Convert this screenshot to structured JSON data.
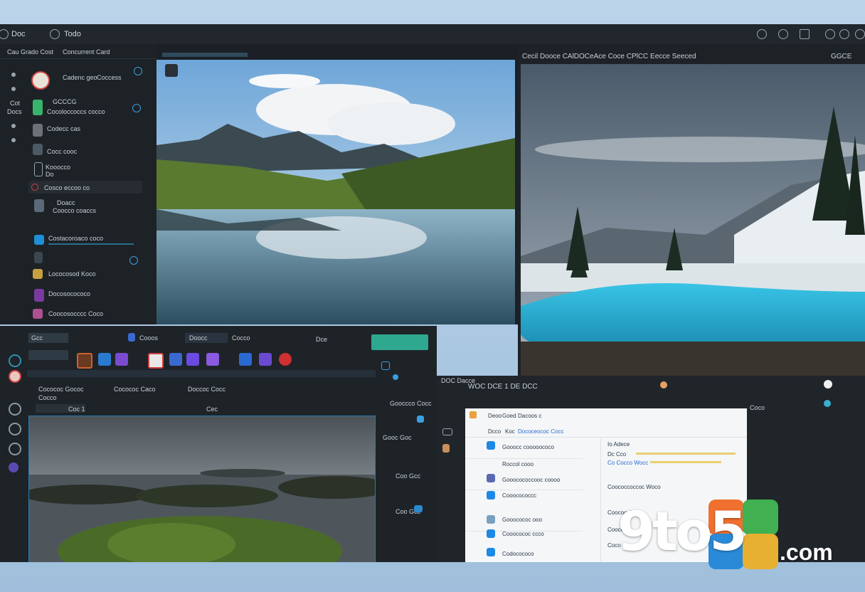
{
  "topbar": {
    "app_label": "Doc",
    "menu_label": "Todo"
  },
  "sidebar": {
    "header": "Cau Grado Cost",
    "header2": "Concurrent Card",
    "nav": [
      "Cot",
      "Docs"
    ],
    "items": [
      {
        "title": "Cadenc geo",
        "sub": "Coccess"
      },
      {
        "title": "GCCCG",
        "sub": "Cocoloccoccs cocco"
      },
      {
        "title": "Codecc cas",
        "sub": ""
      },
      {
        "title": "Cocc cooc",
        "sub": ""
      },
      {
        "title": "Kooocco",
        "sub": "Do"
      },
      {
        "title": "Cosco eccoo co",
        "sub": ""
      },
      {
        "title": "Doacc",
        "sub": "Coocco coaccs"
      },
      {
        "title": "Costacoroaco coco",
        "sub": ""
      },
      {
        "title": "Lococosod Koco",
        "sub": ""
      },
      {
        "title": "Docosocococo",
        "sub": ""
      },
      {
        "title": "Coocosocccc Coco",
        "sub": ""
      }
    ]
  },
  "viewer_right": {
    "title": "Cecil Dooce CAlDOCeAce Coce CPlCC Eecce Seeced",
    "corner": "GGCE"
  },
  "editor": {
    "tabs": [
      "Gcc",
      "Cooos",
      "Doocc",
      "Cocco"
    ],
    "top_label": "Dce",
    "crumbs": [
      "Cocococ Gococ",
      "Cocococ Caco",
      "Doccoc Cocc"
    ],
    "file_label": "Cocco",
    "field": "Coc 1",
    "field2": "Cec",
    "side_labels": [
      "Gooccco Cocc",
      "Gooc Goc",
      "Coo Gcc",
      "Coo Gcc"
    ]
  },
  "mail": {
    "window_label": "WOC DCE 1 DE DCC",
    "title": "DOC Dacce",
    "toolbar": [
      "Deoo",
      "Goed",
      "Dacoos c"
    ],
    "tabs": [
      "Dcco",
      "Koc",
      "Dococeococ Cocc"
    ],
    "rows": [
      {
        "a": "Gooocc cooooococo",
        "b": "Roccol cooo"
      },
      {
        "a": "Gooocococcooc coooo",
        "b": ""
      },
      {
        "a": "Cooocococcc",
        "b": ""
      },
      {
        "a": "Gooocococ ooo",
        "b": ""
      },
      {
        "a": "Cooocococ ccco",
        "b": ""
      },
      {
        "a": "Codocococo",
        "b": ""
      }
    ],
    "detail_title": "Io Adece",
    "detail_lines": [
      "Dc Cco",
      "Co Cocco Wocc",
      "Coococcoccoc Woco",
      "Coocoo Coco",
      "Coococcc",
      "Coco"
    ],
    "right_label": "Coco"
  },
  "watermark": {
    "text": "9to5",
    "domain": ".com"
  }
}
